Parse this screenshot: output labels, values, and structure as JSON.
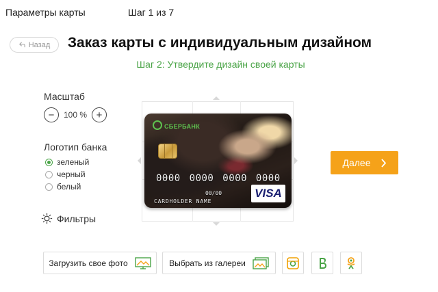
{
  "header": {
    "title": "Параметры карты",
    "step": "Шаг 1 из 7"
  },
  "back_button": {
    "label": "Назад"
  },
  "page": {
    "title": "Заказ карты с индивидуальным дизайном",
    "subtitle": "Шаг 2: Утвердите дизайн своей карты"
  },
  "scale": {
    "label": "Масштаб",
    "value": "100 %",
    "minus": "−",
    "plus": "+"
  },
  "bank_logo": {
    "label": "Логотип банка",
    "options": [
      {
        "label": "зеленый",
        "selected": true
      },
      {
        "label": "черный",
        "selected": false
      },
      {
        "label": "белый",
        "selected": false
      }
    ]
  },
  "filters": {
    "label": "Фильтры"
  },
  "card": {
    "bank_name": "СБЕРБАНК",
    "number": "0000 0000 0000 0000",
    "expiry": "00/00",
    "holder": "CARDHOLDER NAME",
    "network": "VISA"
  },
  "next_button": {
    "label": "Далее"
  },
  "toolbar": {
    "upload_label": "Загрузить свое фото",
    "gallery_label": "Выбрать из галереи"
  },
  "colors": {
    "accent_green": "#4aa447",
    "next_orange": "#f5a219",
    "instagram": "#f0a000",
    "vk": "#4aa447",
    "ok": "#f5a219"
  },
  "icons": [
    "back-arrow-icon",
    "sun-filter-icon",
    "chevron-right-icon",
    "upload-photo-icon",
    "gallery-icon",
    "instagram-icon",
    "vk-icon",
    "odnoklassniki-icon"
  ]
}
